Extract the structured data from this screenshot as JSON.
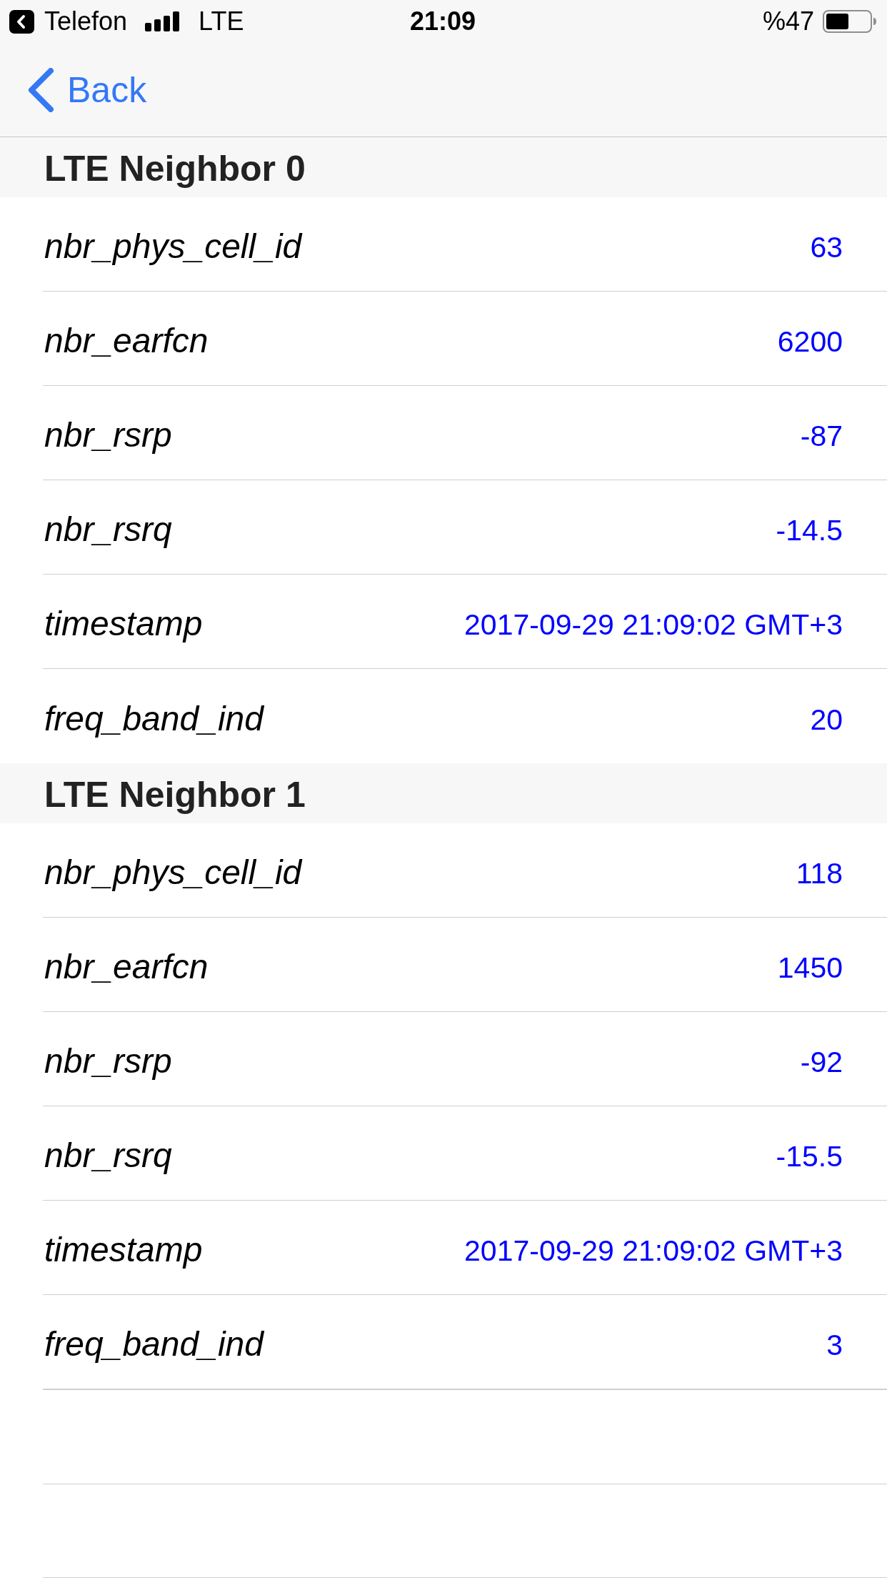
{
  "status_bar": {
    "back_to_app": "Telefon",
    "network": "LTE",
    "time": "21:09",
    "battery": "%47"
  },
  "nav": {
    "back": "Back"
  },
  "sections": [
    {
      "title": "LTE Neighbor 0",
      "rows": [
        {
          "label": "nbr_phys_cell_id",
          "value": "63"
        },
        {
          "label": "nbr_earfcn",
          "value": "6200"
        },
        {
          "label": "nbr_rsrp",
          "value": "-87"
        },
        {
          "label": "nbr_rsrq",
          "value": "-14.5"
        },
        {
          "label": "timestamp",
          "value": "2017-09-29 21:09:02 GMT+3"
        },
        {
          "label": "freq_band_ind",
          "value": "20"
        }
      ]
    },
    {
      "title": "LTE Neighbor 1",
      "rows": [
        {
          "label": "nbr_phys_cell_id",
          "value": "118"
        },
        {
          "label": "nbr_earfcn",
          "value": "1450"
        },
        {
          "label": "nbr_rsrp",
          "value": "-92"
        },
        {
          "label": "nbr_rsrq",
          "value": "-15.5"
        },
        {
          "label": "timestamp",
          "value": "2017-09-29 21:09:02 GMT+3"
        },
        {
          "label": "freq_band_ind",
          "value": "3"
        }
      ]
    }
  ]
}
